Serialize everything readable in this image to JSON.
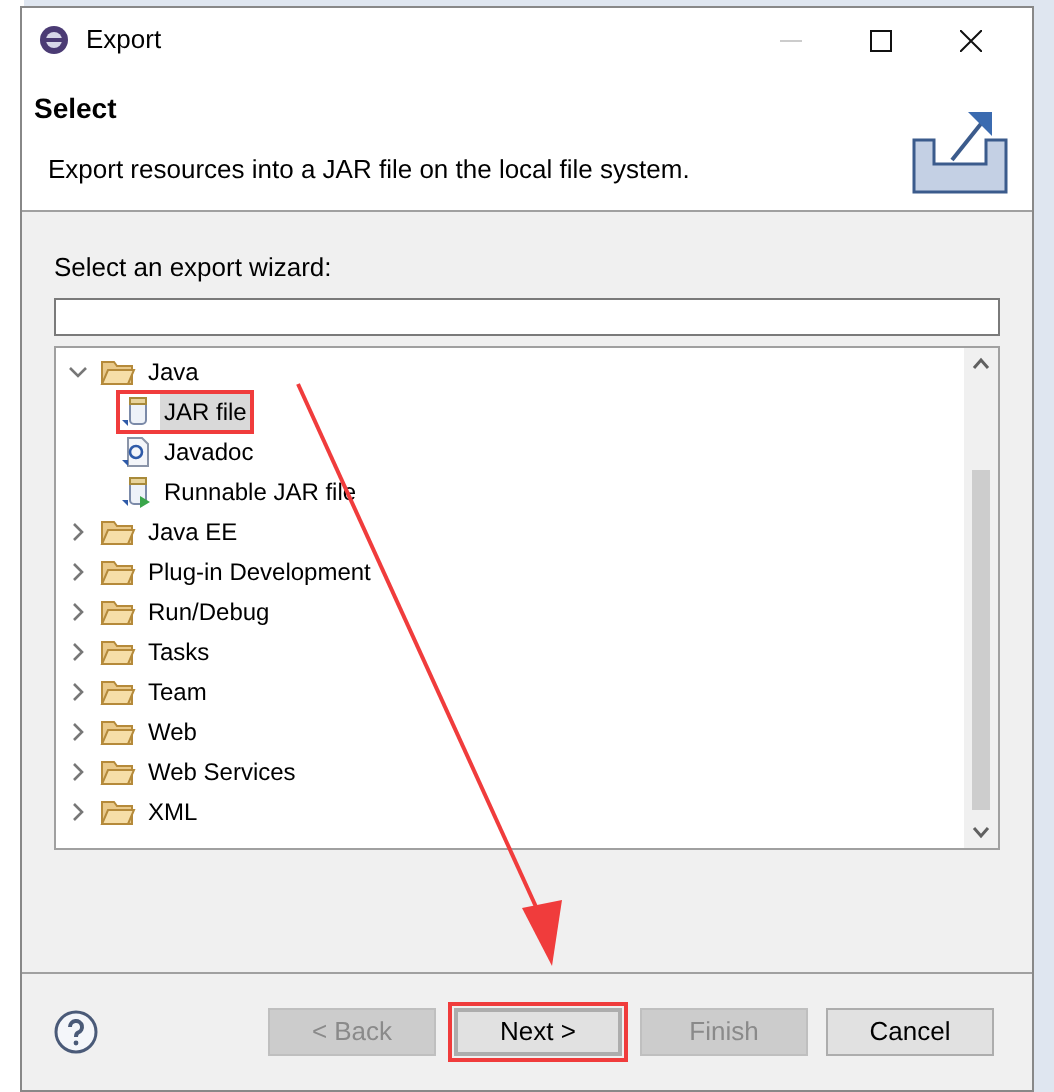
{
  "window": {
    "title": "Export"
  },
  "header": {
    "title": "Select",
    "description": "Export resources into a JAR file on the local file system."
  },
  "filter": {
    "label": "Select an export wizard:"
  },
  "tree": [
    {
      "label": "Java",
      "expanded": true,
      "children": [
        {
          "label": "JAR file",
          "kind": "jar",
          "selected": true,
          "highlighted": true
        },
        {
          "label": "Javadoc",
          "kind": "javadoc",
          "selected": false,
          "highlighted": false
        },
        {
          "label": "Runnable JAR file",
          "kind": "runnable",
          "selected": false,
          "highlighted": false
        }
      ]
    },
    {
      "label": "Java EE",
      "expanded": false
    },
    {
      "label": "Plug-in Development",
      "expanded": false
    },
    {
      "label": "Run/Debug",
      "expanded": false
    },
    {
      "label": "Tasks",
      "expanded": false
    },
    {
      "label": "Team",
      "expanded": false
    },
    {
      "label": "Web",
      "expanded": false
    },
    {
      "label": "Web Services",
      "expanded": false
    },
    {
      "label": "XML",
      "expanded": false
    }
  ],
  "buttons": [
    {
      "label": "< Back",
      "disabled": true,
      "highlighted": false,
      "default": false
    },
    {
      "label": "Next >",
      "disabled": false,
      "highlighted": true,
      "default": true
    },
    {
      "label": "Finish",
      "disabled": true,
      "highlighted": false,
      "default": false
    },
    {
      "label": "Cancel",
      "disabled": false,
      "highlighted": false,
      "default": false
    }
  ]
}
